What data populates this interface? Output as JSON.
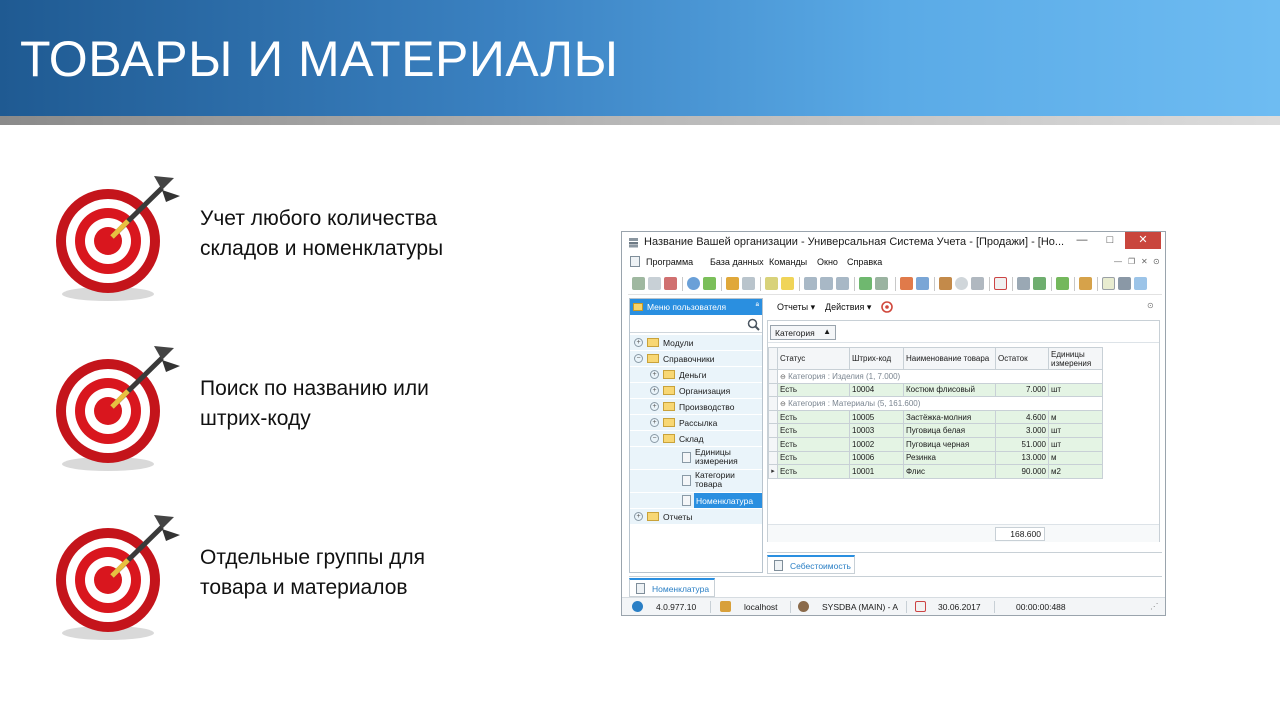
{
  "slide": {
    "title": "ТОВАРЫ И МАТЕРИАЛЫ",
    "header_gradient": [
      "#1f5a92",
      "#6ebcf2"
    ],
    "bullets": [
      {
        "line1": "Учет любого количества",
        "line2": "складов и номенклатуры",
        "icon": "target-icon"
      },
      {
        "line1": "Поиск по названию или",
        "line2": "штрих-коду",
        "icon": "target-icon"
      },
      {
        "line1": "Отдельные группы для",
        "line2": "товара и материалов",
        "icon": "target-icon"
      }
    ]
  },
  "window": {
    "title": "Название Вашей организации - Универсальная Система Учета - [Продажи] - [Но...",
    "controls": {
      "minimize": "—",
      "maximize": "□",
      "close": "✕"
    },
    "menu": [
      "Программа",
      "База данных",
      "Команды",
      "Окно",
      "Справка"
    ],
    "accent": "#2a8fe0"
  },
  "left_panel": {
    "header": "Меню пользователя",
    "pin": "ª",
    "tree": [
      {
        "label": "Модули",
        "level": 0,
        "type": "folder",
        "expander": "+"
      },
      {
        "label": "Справочники",
        "level": 0,
        "type": "folder",
        "expander": "−"
      },
      {
        "label": "Деньги",
        "level": 1,
        "type": "folder",
        "expander": "+"
      },
      {
        "label": "Организация",
        "level": 1,
        "type": "folder",
        "expander": "+"
      },
      {
        "label": "Производство",
        "level": 1,
        "type": "folder",
        "expander": "+"
      },
      {
        "label": "Рассылка",
        "level": 1,
        "type": "folder",
        "expander": "+"
      },
      {
        "label": "Склад",
        "level": 1,
        "type": "folder",
        "expander": "−"
      },
      {
        "label": "Единицы",
        "label2": "измерения",
        "level": 2,
        "type": "doc"
      },
      {
        "label": "Категории",
        "label2": "товара",
        "level": 2,
        "type": "doc"
      },
      {
        "label": "Номенклатура",
        "level": 2,
        "type": "doc",
        "selected": true
      },
      {
        "label": "Отчеты",
        "level": 0,
        "type": "folder",
        "expander": "+"
      }
    ]
  },
  "right_panel": {
    "toolbar": {
      "reports": "Отчеты ▾",
      "actions": "Действия ▾"
    },
    "group_chip": "Категория",
    "columns": [
      "Статус",
      "Штрих-код",
      "Наименование товара",
      "Остаток",
      "Единицы измерения"
    ],
    "groups": [
      {
        "caption": "Категория : Изделия (1, 7.000)",
        "rows": [
          {
            "status": "Есть",
            "barcode": "10004",
            "name": "Костюм флисовый",
            "stock": "7.000",
            "unit": "шт"
          }
        ]
      },
      {
        "caption": "Категория : Материалы (5, 161.600)",
        "rows": [
          {
            "status": "Есть",
            "barcode": "10005",
            "name": "Застёжка-молния",
            "stock": "4.600",
            "unit": "м"
          },
          {
            "status": "Есть",
            "barcode": "10003",
            "name": "Пуговица белая",
            "stock": "3.000",
            "unit": "шт"
          },
          {
            "status": "Есть",
            "barcode": "10002",
            "name": "Пуговица черная",
            "stock": "51.000",
            "unit": "шт"
          },
          {
            "status": "Есть",
            "barcode": "10006",
            "name": "Резинка",
            "stock": "13.000",
            "unit": "м"
          },
          {
            "status": "Есть",
            "barcode": "10001",
            "name": "Флис",
            "stock": "90.000",
            "unit": "м2"
          }
        ]
      }
    ],
    "total": "168.600",
    "bottom_tab": "Себестоимость"
  },
  "doc_tab": "Номенклатура",
  "status_bar": {
    "version": "4.0.977.10",
    "server": "localhost",
    "user": "SYSDBA (MAIN) - A",
    "date": "30.06.2017",
    "timer": "00:00:00:488"
  }
}
